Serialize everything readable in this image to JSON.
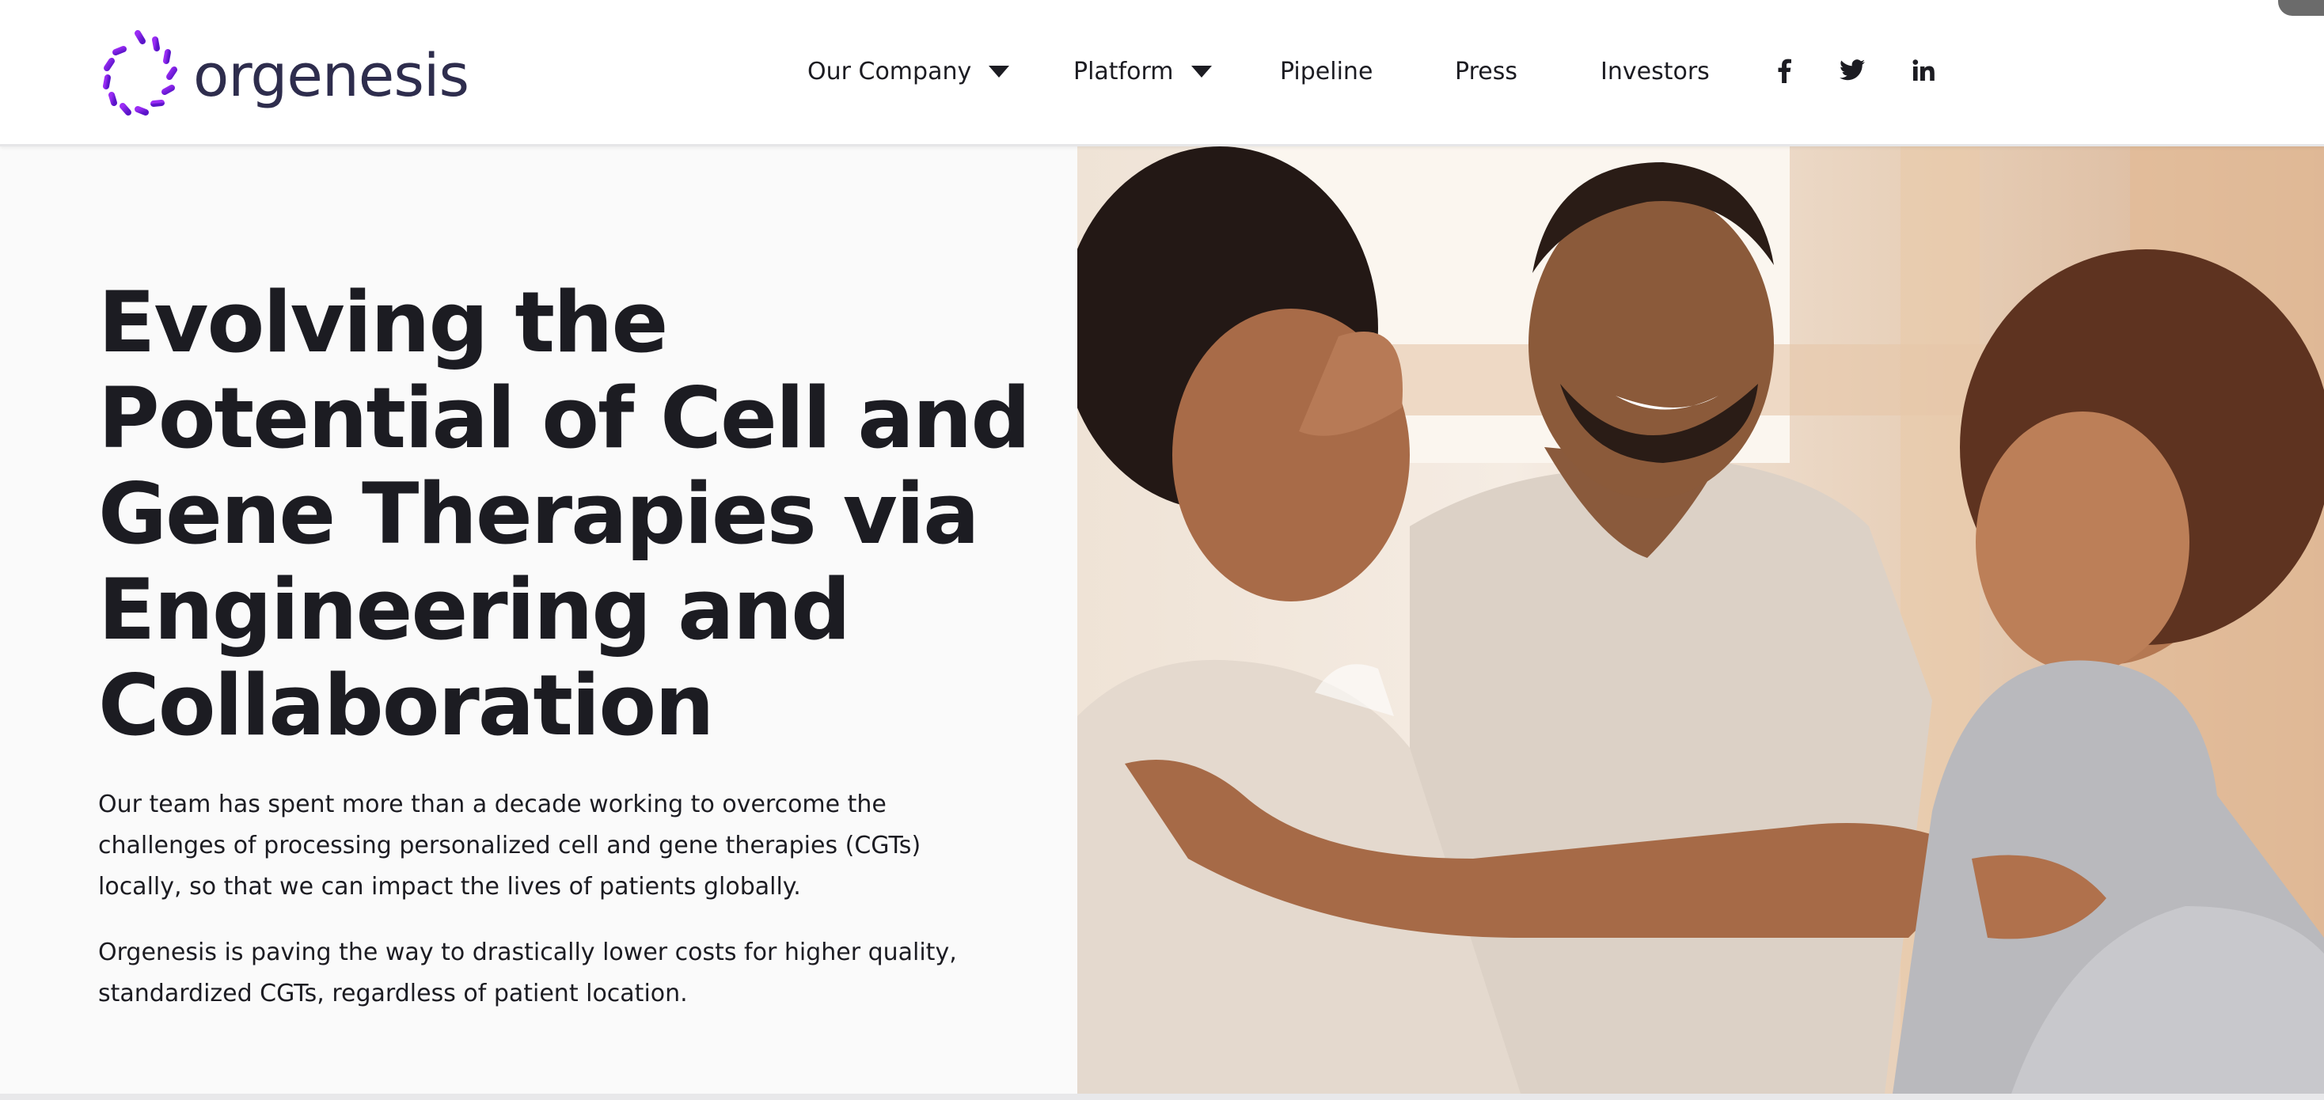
{
  "brand": {
    "name": "orgenesis",
    "accent_colors": [
      "#6a1fd6",
      "#9b2cf5"
    ],
    "text_color": "#2e2d4d"
  },
  "nav": {
    "items": [
      {
        "label": "Our Company",
        "has_dropdown": true
      },
      {
        "label": "Platform",
        "has_dropdown": true
      },
      {
        "label": "Pipeline",
        "has_dropdown": false
      },
      {
        "label": "Press",
        "has_dropdown": false
      },
      {
        "label": "Investors",
        "has_dropdown": false
      }
    ],
    "social": [
      {
        "icon": "facebook-icon",
        "glyph": "f"
      },
      {
        "icon": "twitter-icon",
        "glyph": "bird"
      },
      {
        "icon": "linkedin-icon",
        "glyph": "in"
      }
    ]
  },
  "hero": {
    "headline_lines": [
      "Evolving the",
      "Potential of Cell and",
      "Gene Therapies via",
      "Engineering and",
      "Collaboration"
    ],
    "paragraph_1": "Our team has spent more than a decade working to overcome the challenges of processing personalized cell and gene therapies (CGTs) locally, so that we can impact the lives of patients globally.",
    "paragraph_2": "Orgenesis is paving the way to drastically lower costs for higher quality, standardized CGTs, regardless of patient location.",
    "photo": "family-photo"
  }
}
